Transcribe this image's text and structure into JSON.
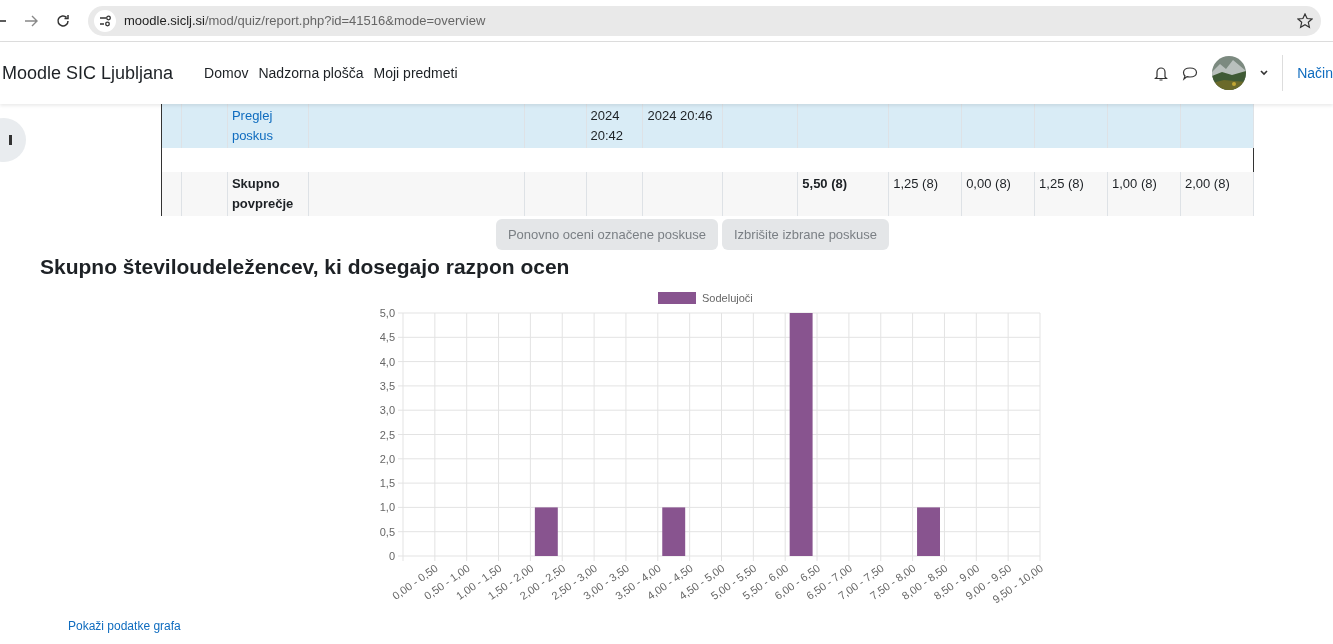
{
  "browser": {
    "url_host": "moodle.siclj.si",
    "url_path": "/mod/quiz/report.php?id=41516&mode=overview"
  },
  "navbar": {
    "site_name": "Moodle SIC Ljubljana",
    "links": [
      {
        "label": "Domov",
        "selected": false
      },
      {
        "label": "Nadzorna plošča",
        "selected": false
      },
      {
        "label": "Moji predmeti",
        "selected": false
      }
    ],
    "mode_link": "Način"
  },
  "table": {
    "rows": [
      {
        "kind": "attempt",
        "selected": true,
        "cells": [
          "",
          "",
          "Preglej poskus",
          "",
          "",
          "2024 20:42",
          "2024 20:46",
          "",
          "",
          "",
          "",
          "",
          "",
          ""
        ]
      },
      {
        "kind": "spacer",
        "selected": false,
        "cells": []
      },
      {
        "kind": "average",
        "selected": false,
        "cells": [
          "",
          "",
          "Skupno povprečje",
          "",
          "",
          "",
          "",
          "",
          "5,50 (8)",
          "1,25 (8)",
          "0,00 (8)",
          "1,25 (8)",
          "1,00 (8)",
          "2,00 (8)"
        ]
      }
    ]
  },
  "buttons": [
    {
      "label": "Ponovno oceni označene poskuse",
      "disabled": true
    },
    {
      "label": "Izbrišite izbrane poskuse",
      "disabled": true
    }
  ],
  "heading": "Skupno številoudeležencev, ki dosegajo razpon ocen",
  "chart": {
    "chart_data": {
      "type": "bar",
      "categories": [
        "0,00 - 0,50",
        "0,50 - 1,00",
        "1,00 - 1,50",
        "1,50 - 2,00",
        "2,00 - 2,50",
        "2,50 - 3,00",
        "3,00 - 3,50",
        "3,50 - 4,00",
        "4,00 - 4,50",
        "4,50 - 5,00",
        "5,00 - 5,50",
        "5,50 - 6,00",
        "6,00 - 6,50",
        "6,50 - 7,00",
        "7,00 - 7,50",
        "7,50 - 8,00",
        "8,00 - 8,50",
        "8,50 - 9,00",
        "9,00 - 9,50",
        "9,50 - 10,00"
      ],
      "series": [
        {
          "name": "Sodelujoči",
          "color": "#88548f",
          "values": [
            0,
            0,
            0,
            0,
            1,
            0,
            0,
            0,
            1,
            0,
            0,
            0,
            5,
            0,
            0,
            0,
            1,
            0,
            0,
            0
          ]
        }
      ],
      "ylim": [
        0,
        5
      ],
      "grid": true,
      "yticks": [
        {
          "value": 0,
          "label": "0"
        },
        {
          "value": 0.5,
          "label": "0,5"
        },
        {
          "value": 1,
          "label": "1,0"
        },
        {
          "value": 1.5,
          "label": "1,5"
        },
        {
          "value": 2,
          "label": "2,0"
        },
        {
          "value": 2.5,
          "label": "2,5"
        },
        {
          "value": 3,
          "label": "3,0"
        },
        {
          "value": 3.5,
          "label": "3,5"
        },
        {
          "value": 4,
          "label": "4,0"
        },
        {
          "value": 4.5,
          "label": "4,5"
        },
        {
          "value": 5,
          "label": "5,0"
        }
      ]
    }
  },
  "show_data_link": "Pokaži podatke grafa"
}
